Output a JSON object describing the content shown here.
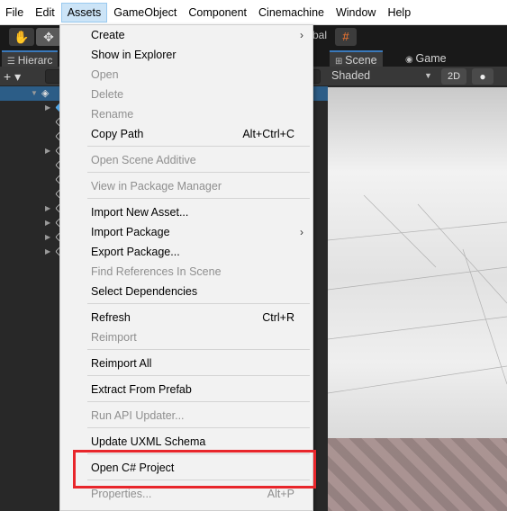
{
  "menubar": {
    "items": [
      "File",
      "Edit",
      "Assets",
      "GameObject",
      "Component",
      "Cinemachine",
      "Window",
      "Help"
    ],
    "active": "Assets"
  },
  "toolbar": {
    "pivot_text": "bal"
  },
  "hierarchy": {
    "tab_label": "Hierarc",
    "plus_label": "+ ▾"
  },
  "scene": {
    "tabs": [
      "Scene",
      "Game"
    ],
    "shading_mode": "Shaded",
    "mode_2d_label": "2D"
  },
  "assets_menu": {
    "items": [
      {
        "label": "Create",
        "shortcut": "",
        "submenu": true,
        "enabled": true
      },
      {
        "label": "Show in Explorer",
        "shortcut": "",
        "submenu": false,
        "enabled": true
      },
      {
        "label": "Open",
        "shortcut": "",
        "submenu": false,
        "enabled": false
      },
      {
        "label": "Delete",
        "shortcut": "",
        "submenu": false,
        "enabled": false
      },
      {
        "label": "Rename",
        "shortcut": "",
        "submenu": false,
        "enabled": false
      },
      {
        "label": "Copy Path",
        "shortcut": "Alt+Ctrl+C",
        "submenu": false,
        "enabled": true
      },
      {
        "label": "Open Scene Additive",
        "shortcut": "",
        "submenu": false,
        "enabled": false
      },
      {
        "label": "View in Package Manager",
        "shortcut": "",
        "submenu": false,
        "enabled": false
      },
      {
        "label": "Import New Asset...",
        "shortcut": "",
        "submenu": false,
        "enabled": true
      },
      {
        "label": "Import Package",
        "shortcut": "",
        "submenu": true,
        "enabled": true
      },
      {
        "label": "Export Package...",
        "shortcut": "",
        "submenu": false,
        "enabled": true
      },
      {
        "label": "Find References In Scene",
        "shortcut": "",
        "submenu": false,
        "enabled": false
      },
      {
        "label": "Select Dependencies",
        "shortcut": "",
        "submenu": false,
        "enabled": true
      },
      {
        "label": "Refresh",
        "shortcut": "Ctrl+R",
        "submenu": false,
        "enabled": true
      },
      {
        "label": "Reimport",
        "shortcut": "",
        "submenu": false,
        "enabled": false
      },
      {
        "label": "Reimport All",
        "shortcut": "",
        "submenu": false,
        "enabled": true
      },
      {
        "label": "Extract From Prefab",
        "shortcut": "",
        "submenu": false,
        "enabled": true
      },
      {
        "label": "Run API Updater...",
        "shortcut": "",
        "submenu": false,
        "enabled": false
      },
      {
        "label": "Update UXML Schema",
        "shortcut": "",
        "submenu": false,
        "enabled": true
      },
      {
        "label": "Open C# Project",
        "shortcut": "",
        "submenu": false,
        "enabled": true
      },
      {
        "label": "Properties...",
        "shortcut": "Alt+P",
        "submenu": false,
        "enabled": false
      }
    ]
  },
  "colors": {
    "highlight": "#e8262b",
    "menu_active_bg": "#cce4f7",
    "selected_row": "#2c5d87"
  }
}
